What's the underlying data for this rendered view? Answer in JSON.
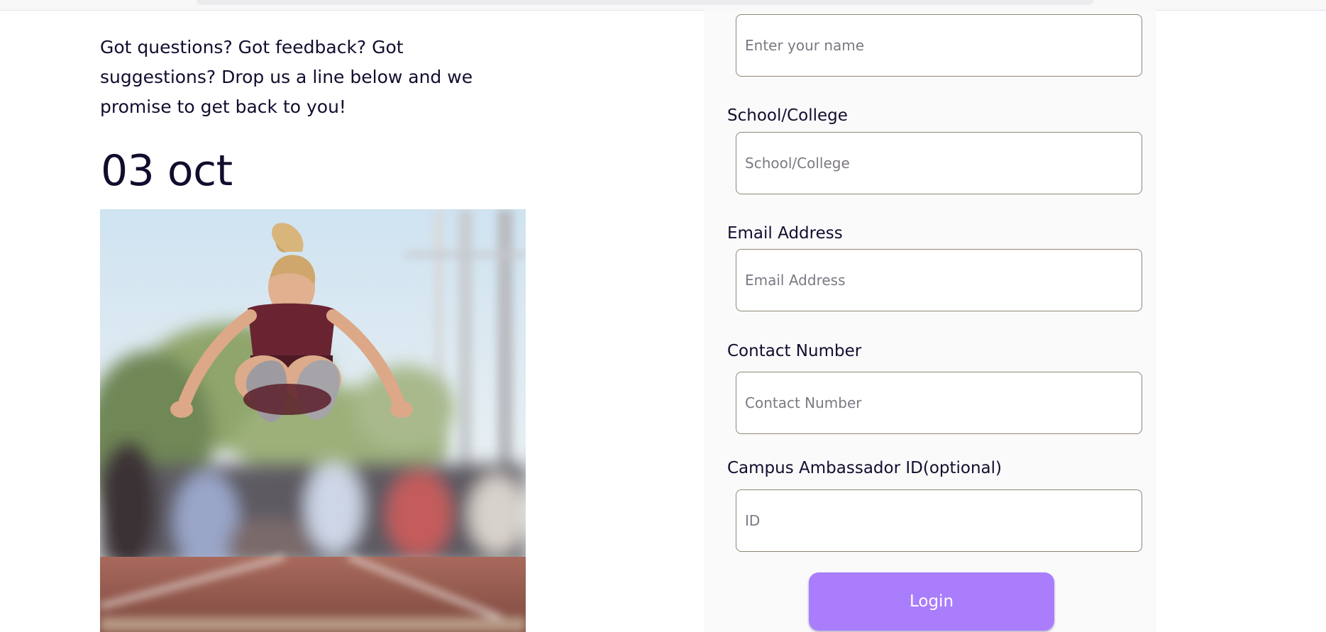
{
  "intro": {
    "text": "Got questions? Got feedback? Got suggestions? Drop us a line below and we promise to get back to you!"
  },
  "event": {
    "date": "03 oct"
  },
  "photo": {
    "alt": "Long jump athlete mid-air over the track"
  },
  "form": {
    "name_placeholder": "Enter your name",
    "school_label": "School/College",
    "school_placeholder": "School/College",
    "email_label": "Email Address",
    "email_placeholder": "Email Address",
    "contact_label": "Contact Number",
    "contact_placeholder": "Contact Number",
    "ambassador_label": "Campus Ambassador ID(optional)",
    "ambassador_placeholder": "ID",
    "submit_label": "Login"
  },
  "colors": {
    "text": "#120d2e",
    "button": "#a97dfc",
    "input_border": "#8f8676",
    "panel": "#fafafb"
  }
}
